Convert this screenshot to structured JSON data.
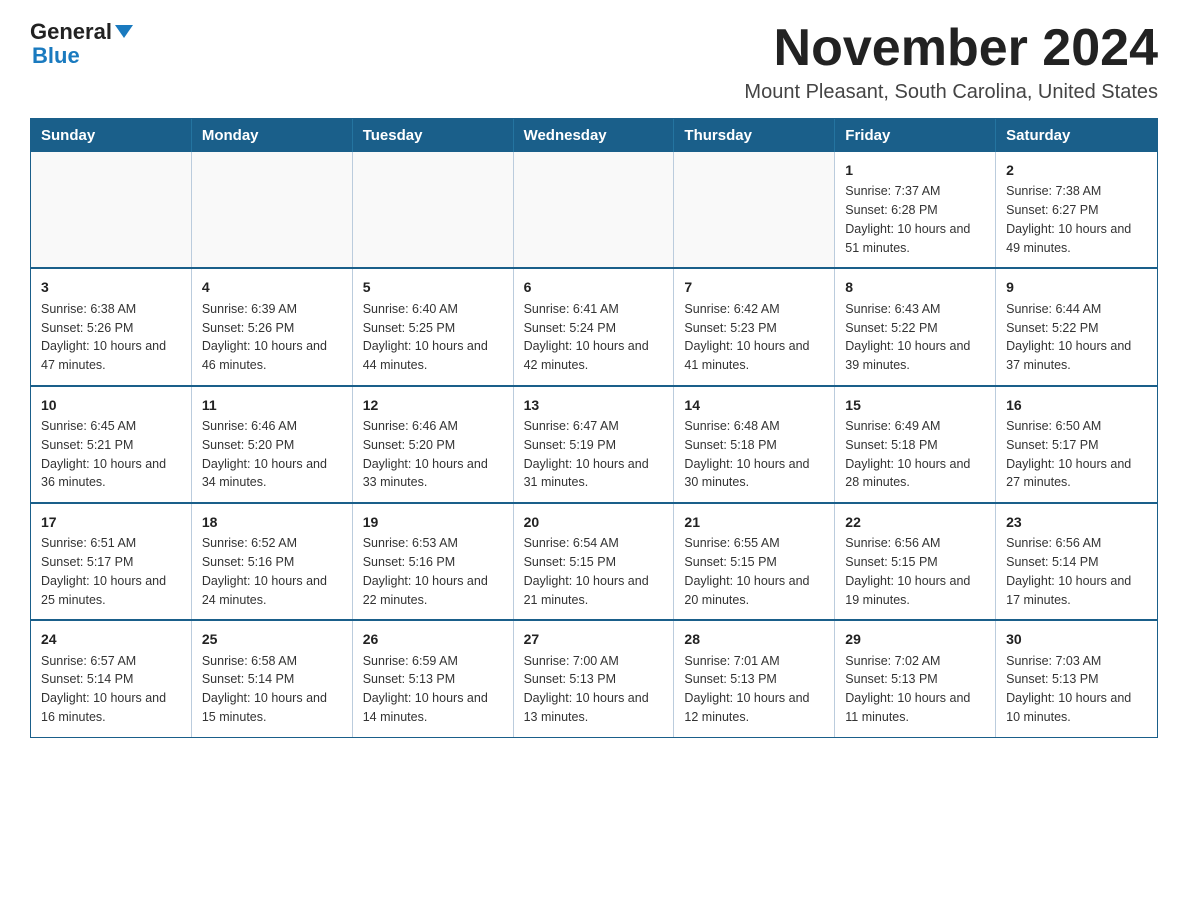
{
  "logo": {
    "text_general": "General",
    "text_blue": "Blue",
    "triangle_symbol": "▶"
  },
  "title": "November 2024",
  "subtitle": "Mount Pleasant, South Carolina, United States",
  "days_of_week": [
    "Sunday",
    "Monday",
    "Tuesday",
    "Wednesday",
    "Thursday",
    "Friday",
    "Saturday"
  ],
  "weeks": [
    [
      {
        "day": "",
        "info": ""
      },
      {
        "day": "",
        "info": ""
      },
      {
        "day": "",
        "info": ""
      },
      {
        "day": "",
        "info": ""
      },
      {
        "day": "",
        "info": ""
      },
      {
        "day": "1",
        "info": "Sunrise: 7:37 AM\nSunset: 6:28 PM\nDaylight: 10 hours and 51 minutes."
      },
      {
        "day": "2",
        "info": "Sunrise: 7:38 AM\nSunset: 6:27 PM\nDaylight: 10 hours and 49 minutes."
      }
    ],
    [
      {
        "day": "3",
        "info": "Sunrise: 6:38 AM\nSunset: 5:26 PM\nDaylight: 10 hours and 47 minutes."
      },
      {
        "day": "4",
        "info": "Sunrise: 6:39 AM\nSunset: 5:26 PM\nDaylight: 10 hours and 46 minutes."
      },
      {
        "day": "5",
        "info": "Sunrise: 6:40 AM\nSunset: 5:25 PM\nDaylight: 10 hours and 44 minutes."
      },
      {
        "day": "6",
        "info": "Sunrise: 6:41 AM\nSunset: 5:24 PM\nDaylight: 10 hours and 42 minutes."
      },
      {
        "day": "7",
        "info": "Sunrise: 6:42 AM\nSunset: 5:23 PM\nDaylight: 10 hours and 41 minutes."
      },
      {
        "day": "8",
        "info": "Sunrise: 6:43 AM\nSunset: 5:22 PM\nDaylight: 10 hours and 39 minutes."
      },
      {
        "day": "9",
        "info": "Sunrise: 6:44 AM\nSunset: 5:22 PM\nDaylight: 10 hours and 37 minutes."
      }
    ],
    [
      {
        "day": "10",
        "info": "Sunrise: 6:45 AM\nSunset: 5:21 PM\nDaylight: 10 hours and 36 minutes."
      },
      {
        "day": "11",
        "info": "Sunrise: 6:46 AM\nSunset: 5:20 PM\nDaylight: 10 hours and 34 minutes."
      },
      {
        "day": "12",
        "info": "Sunrise: 6:46 AM\nSunset: 5:20 PM\nDaylight: 10 hours and 33 minutes."
      },
      {
        "day": "13",
        "info": "Sunrise: 6:47 AM\nSunset: 5:19 PM\nDaylight: 10 hours and 31 minutes."
      },
      {
        "day": "14",
        "info": "Sunrise: 6:48 AM\nSunset: 5:18 PM\nDaylight: 10 hours and 30 minutes."
      },
      {
        "day": "15",
        "info": "Sunrise: 6:49 AM\nSunset: 5:18 PM\nDaylight: 10 hours and 28 minutes."
      },
      {
        "day": "16",
        "info": "Sunrise: 6:50 AM\nSunset: 5:17 PM\nDaylight: 10 hours and 27 minutes."
      }
    ],
    [
      {
        "day": "17",
        "info": "Sunrise: 6:51 AM\nSunset: 5:17 PM\nDaylight: 10 hours and 25 minutes."
      },
      {
        "day": "18",
        "info": "Sunrise: 6:52 AM\nSunset: 5:16 PM\nDaylight: 10 hours and 24 minutes."
      },
      {
        "day": "19",
        "info": "Sunrise: 6:53 AM\nSunset: 5:16 PM\nDaylight: 10 hours and 22 minutes."
      },
      {
        "day": "20",
        "info": "Sunrise: 6:54 AM\nSunset: 5:15 PM\nDaylight: 10 hours and 21 minutes."
      },
      {
        "day": "21",
        "info": "Sunrise: 6:55 AM\nSunset: 5:15 PM\nDaylight: 10 hours and 20 minutes."
      },
      {
        "day": "22",
        "info": "Sunrise: 6:56 AM\nSunset: 5:15 PM\nDaylight: 10 hours and 19 minutes."
      },
      {
        "day": "23",
        "info": "Sunrise: 6:56 AM\nSunset: 5:14 PM\nDaylight: 10 hours and 17 minutes."
      }
    ],
    [
      {
        "day": "24",
        "info": "Sunrise: 6:57 AM\nSunset: 5:14 PM\nDaylight: 10 hours and 16 minutes."
      },
      {
        "day": "25",
        "info": "Sunrise: 6:58 AM\nSunset: 5:14 PM\nDaylight: 10 hours and 15 minutes."
      },
      {
        "day": "26",
        "info": "Sunrise: 6:59 AM\nSunset: 5:13 PM\nDaylight: 10 hours and 14 minutes."
      },
      {
        "day": "27",
        "info": "Sunrise: 7:00 AM\nSunset: 5:13 PM\nDaylight: 10 hours and 13 minutes."
      },
      {
        "day": "28",
        "info": "Sunrise: 7:01 AM\nSunset: 5:13 PM\nDaylight: 10 hours and 12 minutes."
      },
      {
        "day": "29",
        "info": "Sunrise: 7:02 AM\nSunset: 5:13 PM\nDaylight: 10 hours and 11 minutes."
      },
      {
        "day": "30",
        "info": "Sunrise: 7:03 AM\nSunset: 5:13 PM\nDaylight: 10 hours and 10 minutes."
      }
    ]
  ]
}
